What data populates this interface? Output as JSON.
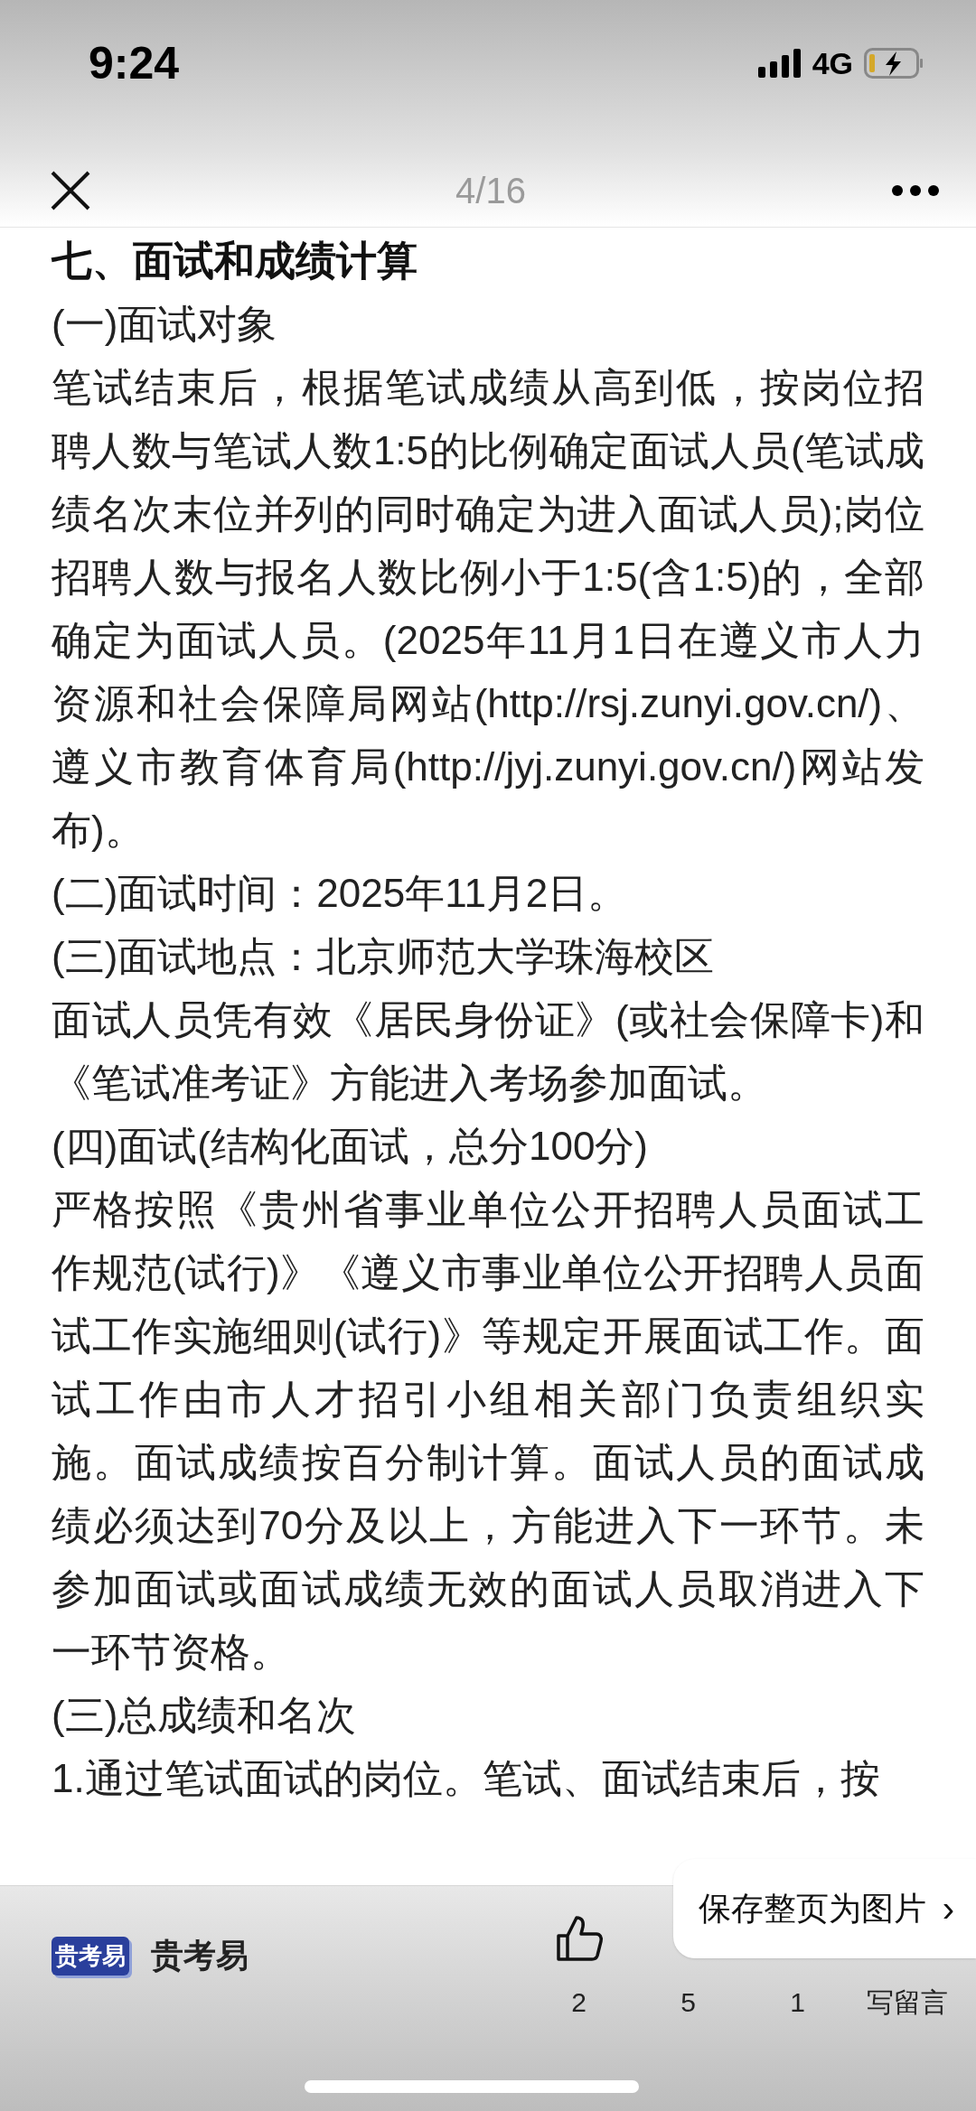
{
  "status_bar": {
    "time": "9:24",
    "network": "4G"
  },
  "nav": {
    "page_counter": "4/16"
  },
  "article": {
    "paragraphs": [
      {
        "kind": "heading",
        "text": "七、面试和成绩计算"
      },
      {
        "kind": "body",
        "text": "(一)面试对象"
      },
      {
        "kind": "body",
        "text": "笔试结束后，根据笔试成绩从高到低，按岗位招聘人数与笔试人数1:5的比例确定面试人员(笔试成绩名次末位并列的同时确定为进入面试人员);岗位招聘人数与报名人数比例小于1:5(含1:5)的，全部确定为面试人员。(2025年11月1日在遵义市人力资源和社会保障局网站(http://rsj.zunyi.gov.cn/)、遵义市教育体育局(http://jyj.zunyi.gov.cn/)网站发布)。"
      },
      {
        "kind": "body",
        "text": "(二)面试时间：2025年11月2日。"
      },
      {
        "kind": "body",
        "text": "(三)面试地点：北京师范大学珠海校区"
      },
      {
        "kind": "body",
        "text": "面试人员凭有效《居民身份证》(或社会保障卡)和《笔试准考证》方能进入考场参加面试。"
      },
      {
        "kind": "body",
        "text": "(四)面试(结构化面试，总分100分)"
      },
      {
        "kind": "body",
        "text": "严格按照《贵州省事业单位公开招聘人员面试工作规范(试行)》《遵义市事业单位公开招聘人员面试工作实施细则(试行)》等规定开展面试工作。面试工作由市人才招引小组相关部门负责组织实施。面试成绩按百分制计算。面试人员的面试成绩必须达到70分及以上，方能进入下一环节。未参加面试或面试成绩无效的面试人员取消进入下一环节资格。"
      },
      {
        "kind": "body",
        "text": "(三)总成绩和名次"
      },
      {
        "kind": "body",
        "text": "1.通过笔试面试的岗位。笔试、面试结束后，按"
      }
    ]
  },
  "bottom_bar": {
    "account_logo": "贵考易",
    "account_name": "贵考易",
    "actions": [
      {
        "kind": "thumb",
        "text": "2"
      },
      {
        "kind": "hidden",
        "text": "5"
      },
      {
        "kind": "hidden",
        "text": "1"
      },
      {
        "kind": "hidden",
        "text": "写留言"
      }
    ],
    "popup": {
      "text": "保存整页为图片",
      "chevron": "›"
    }
  }
}
